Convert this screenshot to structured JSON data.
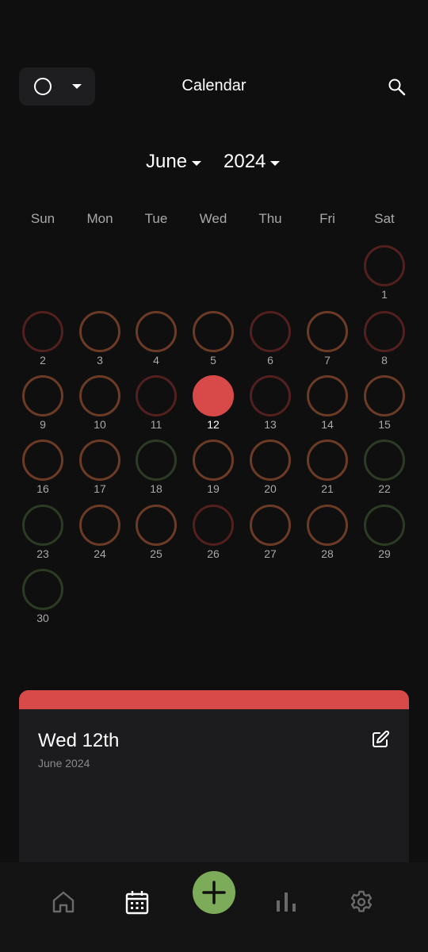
{
  "header": {
    "title": "Calendar",
    "filter_icon": "circle-outline-icon",
    "search_icon": "search-icon"
  },
  "selector": {
    "month": "June",
    "year": "2024"
  },
  "weekdays": [
    "Sun",
    "Mon",
    "Tue",
    "Wed",
    "Thu",
    "Fri",
    "Sat"
  ],
  "calendar": {
    "first_weekday_index": 6,
    "selected_day": 12,
    "days": [
      {
        "label": "1",
        "mood": "red"
      },
      {
        "label": "2",
        "mood": "red"
      },
      {
        "label": "3",
        "mood": "orange"
      },
      {
        "label": "4",
        "mood": "orange"
      },
      {
        "label": "5",
        "mood": "orange"
      },
      {
        "label": "6",
        "mood": "red"
      },
      {
        "label": "7",
        "mood": "orange"
      },
      {
        "label": "8",
        "mood": "red"
      },
      {
        "label": "9",
        "mood": "orange"
      },
      {
        "label": "10",
        "mood": "orange"
      },
      {
        "label": "11",
        "mood": "red"
      },
      {
        "label": "12",
        "mood": "selected"
      },
      {
        "label": "13",
        "mood": "red"
      },
      {
        "label": "14",
        "mood": "orange"
      },
      {
        "label": "15",
        "mood": "orange"
      },
      {
        "label": "16",
        "mood": "orange"
      },
      {
        "label": "17",
        "mood": "orange"
      },
      {
        "label": "18",
        "mood": "green"
      },
      {
        "label": "19",
        "mood": "orange"
      },
      {
        "label": "20",
        "mood": "orange"
      },
      {
        "label": "21",
        "mood": "orange"
      },
      {
        "label": "22",
        "mood": "green"
      },
      {
        "label": "23",
        "mood": "green"
      },
      {
        "label": "24",
        "mood": "orange"
      },
      {
        "label": "25",
        "mood": "orange"
      },
      {
        "label": "26",
        "mood": "red"
      },
      {
        "label": "27",
        "mood": "orange"
      },
      {
        "label": "28",
        "mood": "orange"
      },
      {
        "label": "29",
        "mood": "green"
      },
      {
        "label": "30",
        "mood": "green"
      }
    ]
  },
  "detail": {
    "title": "Wed 12th",
    "subtitle": "June 2024",
    "accent": "#d84a4a",
    "edit_icon": "edit-icon"
  },
  "nav": {
    "items": [
      "home-icon",
      "calendar-icon",
      "add-icon",
      "stats-icon",
      "settings-icon"
    ],
    "active": "calendar-icon",
    "add_color": "#7cac5a"
  },
  "colors": {
    "background": "#0f0f0f",
    "ring_red": "#52201e",
    "ring_orange": "#6b3b26",
    "ring_green": "#2c3c24",
    "selected": "#d84a4a"
  }
}
